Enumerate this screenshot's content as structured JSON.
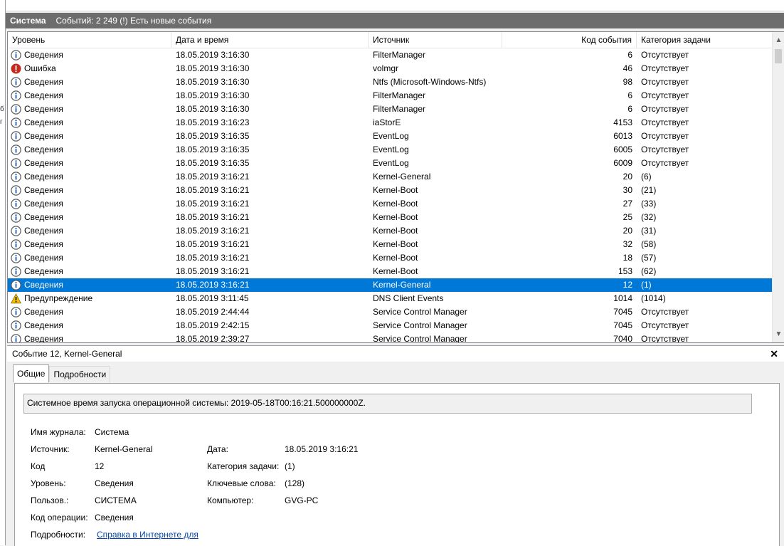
{
  "window": {
    "log_name": "Система",
    "event_summary": "Событий: 2 249 (!) Есть новые события"
  },
  "columns": {
    "level": "Уровень",
    "datetime": "Дата и время",
    "source": "Источник",
    "event_id": "Код события",
    "task_category": "Категория задачи"
  },
  "events": [
    {
      "level": "Сведения",
      "type": "info",
      "datetime": "18.05.2019 3:16:30",
      "source": "FilterManager",
      "event_id": "6",
      "category": "Отсутствует"
    },
    {
      "level": "Ошибка",
      "type": "error",
      "datetime": "18.05.2019 3:16:30",
      "source": "volmgr",
      "event_id": "46",
      "category": "Отсутствует"
    },
    {
      "level": "Сведения",
      "type": "info",
      "datetime": "18.05.2019 3:16:30",
      "source": "Ntfs (Microsoft-Windows-Ntfs)",
      "event_id": "98",
      "category": "Отсутствует"
    },
    {
      "level": "Сведения",
      "type": "info",
      "datetime": "18.05.2019 3:16:30",
      "source": "FilterManager",
      "event_id": "6",
      "category": "Отсутствует"
    },
    {
      "level": "Сведения",
      "type": "info",
      "datetime": "18.05.2019 3:16:30",
      "source": "FilterManager",
      "event_id": "6",
      "category": "Отсутствует"
    },
    {
      "level": "Сведения",
      "type": "info",
      "datetime": "18.05.2019 3:16:23",
      "source": "iaStorE",
      "event_id": "4153",
      "category": "Отсутствует"
    },
    {
      "level": "Сведения",
      "type": "info",
      "datetime": "18.05.2019 3:16:35",
      "source": "EventLog",
      "event_id": "6013",
      "category": "Отсутствует"
    },
    {
      "level": "Сведения",
      "type": "info",
      "datetime": "18.05.2019 3:16:35",
      "source": "EventLog",
      "event_id": "6005",
      "category": "Отсутствует"
    },
    {
      "level": "Сведения",
      "type": "info",
      "datetime": "18.05.2019 3:16:35",
      "source": "EventLog",
      "event_id": "6009",
      "category": "Отсутствует"
    },
    {
      "level": "Сведения",
      "type": "info",
      "datetime": "18.05.2019 3:16:21",
      "source": "Kernel-General",
      "event_id": "20",
      "category": "(6)"
    },
    {
      "level": "Сведения",
      "type": "info",
      "datetime": "18.05.2019 3:16:21",
      "source": "Kernel-Boot",
      "event_id": "30",
      "category": "(21)"
    },
    {
      "level": "Сведения",
      "type": "info",
      "datetime": "18.05.2019 3:16:21",
      "source": "Kernel-Boot",
      "event_id": "27",
      "category": "(33)"
    },
    {
      "level": "Сведения",
      "type": "info",
      "datetime": "18.05.2019 3:16:21",
      "source": "Kernel-Boot",
      "event_id": "25",
      "category": "(32)"
    },
    {
      "level": "Сведения",
      "type": "info",
      "datetime": "18.05.2019 3:16:21",
      "source": "Kernel-Boot",
      "event_id": "20",
      "category": "(31)"
    },
    {
      "level": "Сведения",
      "type": "info",
      "datetime": "18.05.2019 3:16:21",
      "source": "Kernel-Boot",
      "event_id": "32",
      "category": "(58)"
    },
    {
      "level": "Сведения",
      "type": "info",
      "datetime": "18.05.2019 3:16:21",
      "source": "Kernel-Boot",
      "event_id": "18",
      "category": "(57)"
    },
    {
      "level": "Сведения",
      "type": "info",
      "datetime": "18.05.2019 3:16:21",
      "source": "Kernel-Boot",
      "event_id": "153",
      "category": "(62)"
    },
    {
      "level": "Сведения",
      "type": "info",
      "datetime": "18.05.2019 3:16:21",
      "source": "Kernel-General",
      "event_id": "12",
      "category": "(1)",
      "selected": true
    },
    {
      "level": "Предупреждение",
      "type": "warning",
      "datetime": "18.05.2019 3:11:45",
      "source": "DNS Client Events",
      "event_id": "1014",
      "category": "(1014)"
    },
    {
      "level": "Сведения",
      "type": "info",
      "datetime": "18.05.2019 2:44:44",
      "source": "Service Control Manager",
      "event_id": "7045",
      "category": "Отсутствует"
    },
    {
      "level": "Сведения",
      "type": "info",
      "datetime": "18.05.2019 2:42:15",
      "source": "Service Control Manager",
      "event_id": "7045",
      "category": "Отсутствует"
    },
    {
      "level": "Сведения",
      "type": "info",
      "datetime": "18.05.2019 2:39:27",
      "source": "Service Control Manager",
      "event_id": "7040",
      "category": "Отсутствует"
    }
  ],
  "detail": {
    "title": "Событие 12, Kernel-General",
    "close_icon": "close-icon",
    "tabs": [
      "Общие",
      "Подробности"
    ],
    "message": "Системное время запуска операционной системы: 2019-05-18T00:16:21.500000000Z.",
    "fields": {
      "log_name_label": "Имя журнала:",
      "log_name": "Система",
      "source_label": "Источник:",
      "source": "Kernel-General",
      "date_label": "Дата:",
      "date": "18.05.2019 3:16:21",
      "code_label": "Код",
      "code": "12",
      "category_label": "Категория задачи:",
      "category": "(1)",
      "level_label": "Уровень:",
      "level": "Сведения",
      "keywords_label": "Ключевые слова:",
      "keywords": "(128)",
      "user_label": "Пользов.:",
      "user": "СИСТЕМА",
      "computer_label": "Компьютер:",
      "computer": "GVG-PC",
      "opcode_label": "Код операции:",
      "opcode": "Сведения",
      "details_label": "Подробности:",
      "details_link": "Справка в Интернете для"
    }
  },
  "colors": {
    "selection": "#0078d7",
    "titlebar": "#6d6d6d",
    "link": "#0645ad"
  }
}
